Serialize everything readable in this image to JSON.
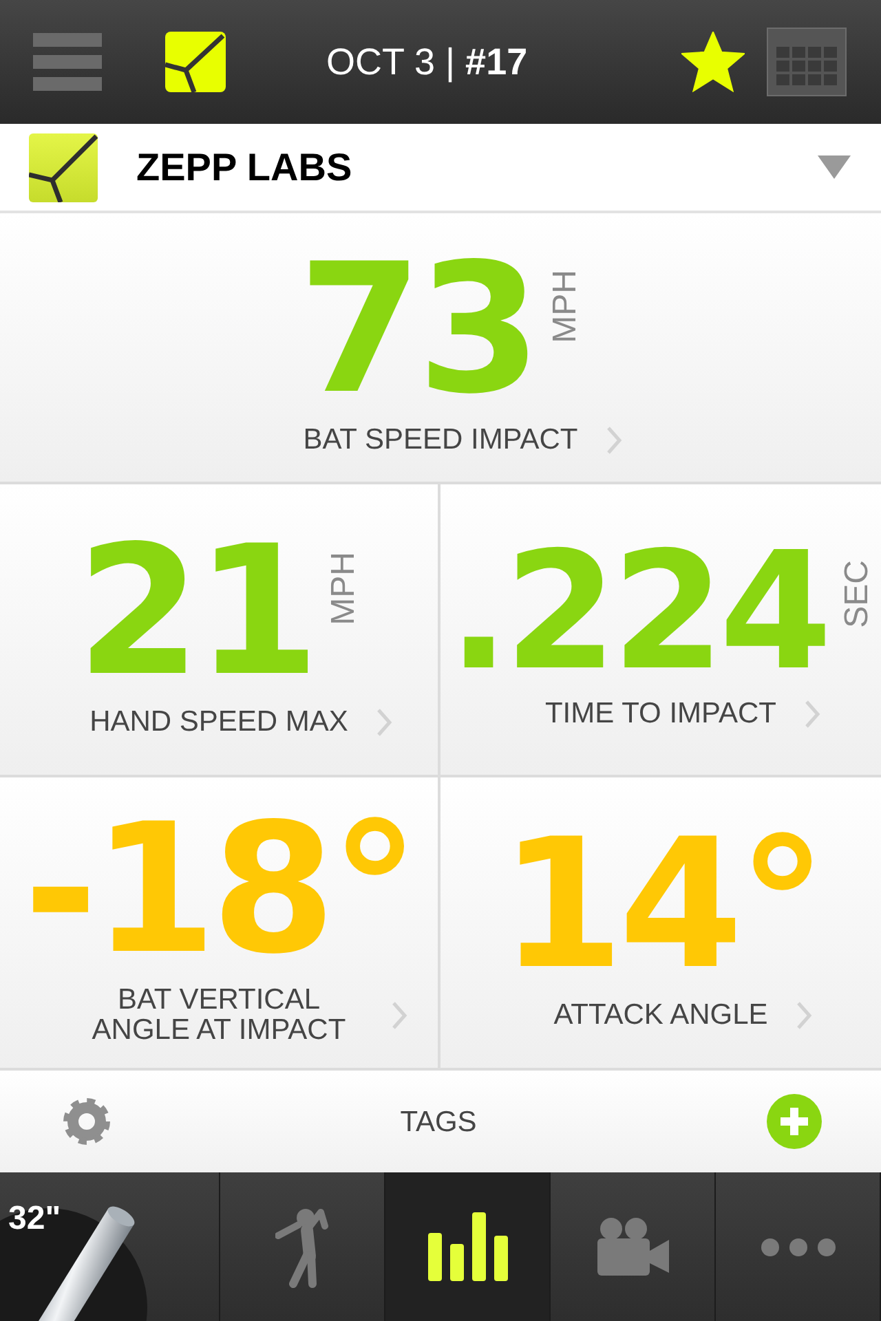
{
  "header": {
    "title": "OCT 3 | **#17**",
    "favorite": true
  },
  "selector": {
    "name": "ZEPP LABS"
  },
  "metrics": [
    {
      "value": "73",
      "unit": "MPH",
      "label": "BAT SPEED IMPACT",
      "color": "#8ad611"
    },
    {
      "value": "21",
      "unit": "MPH",
      "label": "HAND SPEED MAX",
      "color": "#8ad611"
    },
    {
      "value": ".224",
      "unit": "SEC",
      "label": "TIME TO IMPACT",
      "color": "#8ad611"
    },
    {
      "value": "-18°",
      "label": "BAT VERTICAL ANGLE AT IMPACT",
      "color": "#ffc805"
    },
    {
      "value": "14°",
      "label": "ATTACK ANGLE",
      "color": "#ffc805"
    }
  ],
  "tags_bar": {
    "label": "TAGS"
  },
  "tab_bar": [
    {
      "kind": "bat",
      "label": "32\"",
      "selected": false
    },
    {
      "kind": "swing",
      "selected": false
    },
    {
      "kind": "stats",
      "selected": true
    },
    {
      "kind": "video",
      "selected": false
    },
    {
      "kind": "more",
      "selected": false
    }
  ]
}
